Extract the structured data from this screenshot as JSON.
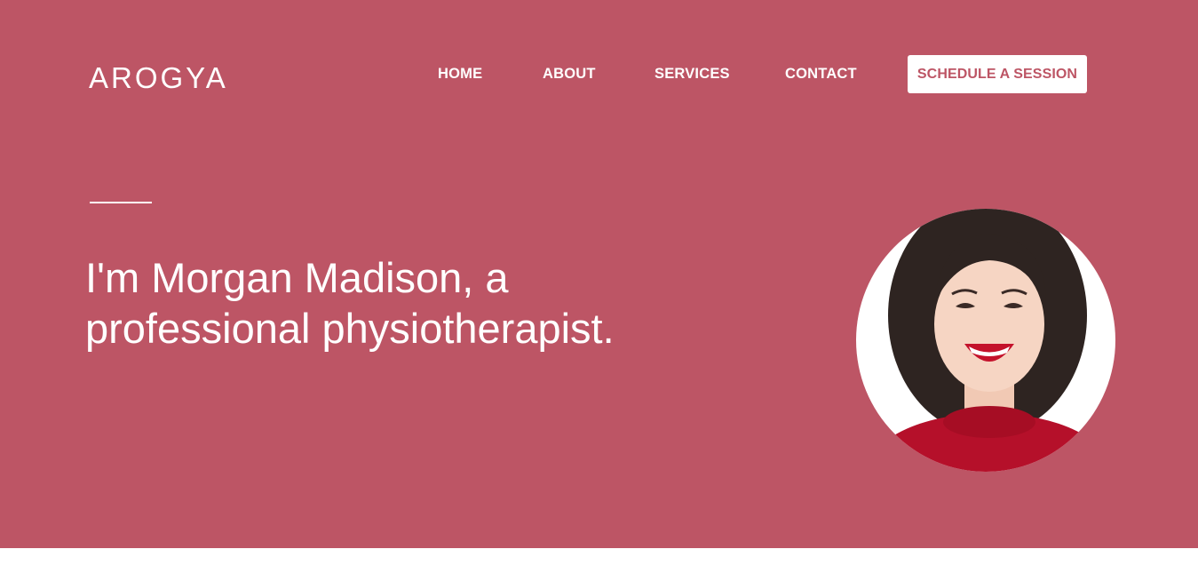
{
  "brand": {
    "logo_text": "AROGYA"
  },
  "nav": {
    "items": [
      {
        "label": "HOME"
      },
      {
        "label": "ABOUT"
      },
      {
        "label": "SERVICES"
      },
      {
        "label": "CONTACT"
      }
    ],
    "cta_label": "SCHEDULE A SESSION"
  },
  "hero": {
    "headline": "I'm Morgan Madison, a professional physiotherapist."
  },
  "colors": {
    "brand": "#bd5565",
    "text_on_brand": "#ffffff"
  }
}
